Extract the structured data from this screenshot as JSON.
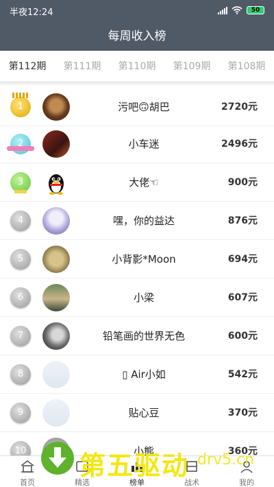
{
  "status_bar": {
    "time": "半夜12:24",
    "battery": "50"
  },
  "header": {
    "title": "每周收入榜"
  },
  "tabs": [
    {
      "label": "第112期",
      "active": true
    },
    {
      "label": "第111期"
    },
    {
      "label": "第110期"
    },
    {
      "label": "第109期"
    },
    {
      "label": "第108期"
    }
  ],
  "rankings": [
    {
      "rank": "1",
      "name": "污吧🙃胡巴",
      "amount": "2720元"
    },
    {
      "rank": "2",
      "name": "小车迷",
      "amount": "2496元"
    },
    {
      "rank": "3",
      "name": "大佬☜",
      "amount": "900元"
    },
    {
      "rank": "4",
      "name": "嘿，你的益达",
      "amount": "876元"
    },
    {
      "rank": "5",
      "name": "小背影*Moon",
      "amount": "694元"
    },
    {
      "rank": "6",
      "name": "小梁",
      "amount": "607元"
    },
    {
      "rank": "7",
      "name": "铅笔画的世界无色",
      "amount": "600元"
    },
    {
      "rank": "8",
      "name": "▯ Air小如",
      "amount": "542元"
    },
    {
      "rank": "9",
      "name": "贴心豆",
      "amount": "370元"
    },
    {
      "rank": "10",
      "name": "小熊",
      "amount": "360元"
    }
  ],
  "bottom_nav": [
    {
      "label": "首页",
      "icon": "home-icon"
    },
    {
      "label": "精选",
      "icon": "featured-icon"
    },
    {
      "label": "榜单",
      "icon": "ranking-icon",
      "active": true
    },
    {
      "label": "战术",
      "icon": "tactics-icon"
    },
    {
      "label": "我的",
      "icon": "profile-icon"
    }
  ],
  "watermark": {
    "text": "第五驱动",
    "url": "drv5.cn"
  },
  "colors": {
    "header_bg": "#505a67",
    "active_tab": "#333333",
    "inactive_tab": "#aaaaaa",
    "watermark": "#f2e600"
  }
}
